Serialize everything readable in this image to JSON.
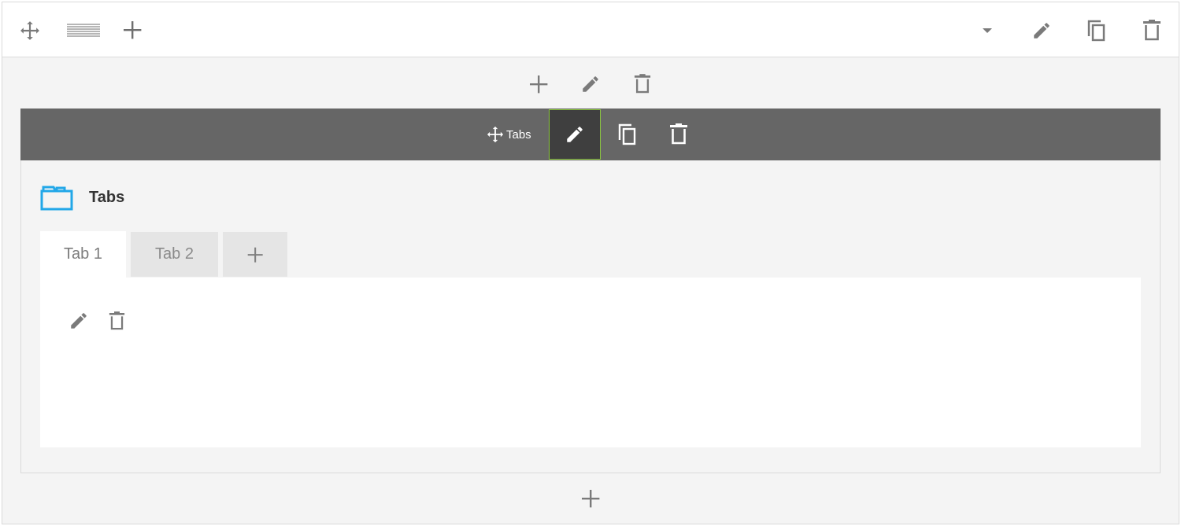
{
  "row_toolbar": {
    "left_icons": [
      "move-icon",
      "layout-icon",
      "plus-icon"
    ],
    "right_icons": [
      "caret-down-icon",
      "pencil-icon",
      "copy-icon",
      "trash-icon"
    ]
  },
  "column_toolbar": {
    "icons": [
      "plus-icon",
      "pencil-icon",
      "trash-icon"
    ]
  },
  "module_toolbar": {
    "drag_label": "Tabs",
    "icons": [
      "pencil-icon",
      "copy-icon",
      "trash-icon"
    ]
  },
  "module": {
    "title": "Tabs",
    "icon": "folder-icon",
    "icon_color": "#22a7e8",
    "tabs": [
      {
        "label": "Tab 1",
        "active": true
      },
      {
        "label": "Tab 2",
        "active": false
      }
    ],
    "add_tab_icon": "plus-icon",
    "panel_icons": [
      "pencil-icon",
      "trash-icon"
    ]
  },
  "bottom": {
    "add_icon": "plus-icon"
  },
  "colors": {
    "toolbar_dark": "#666666",
    "active_button_bg": "#3f3f3f",
    "active_button_border": "#8cc63f",
    "icon_gray": "#7a7a7a"
  }
}
